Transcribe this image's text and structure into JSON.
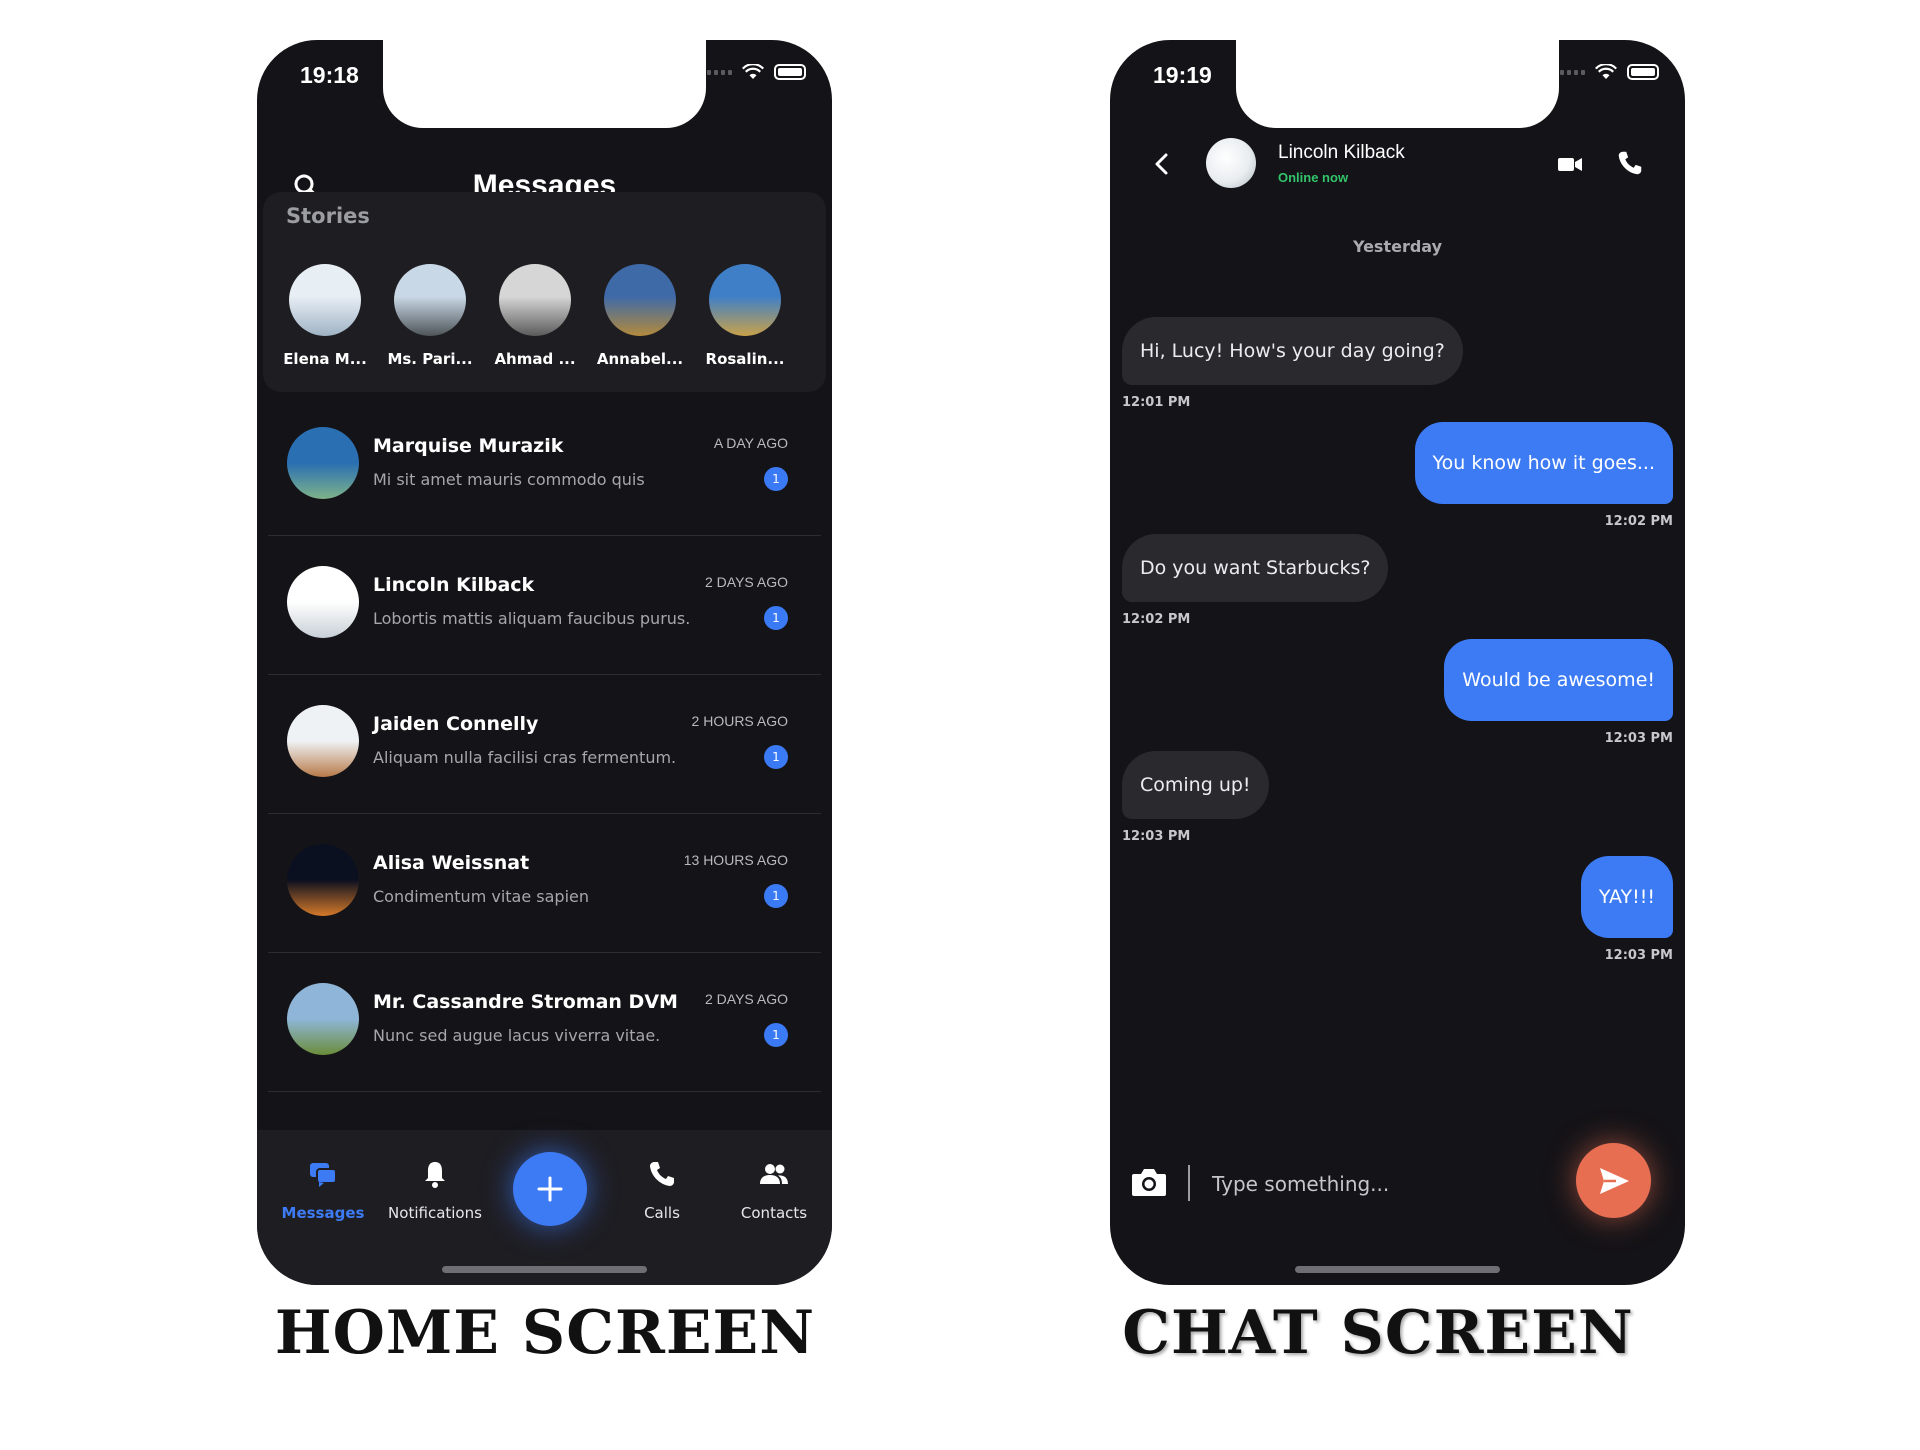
{
  "home": {
    "status_time": "19:18",
    "title": "Messages",
    "stories_title": "Stories",
    "stories": [
      {
        "name": "Elena M...",
        "colors": [
          "#e7eef4",
          "#9fb3c5"
        ]
      },
      {
        "name": "Ms. Pari...",
        "colors": [
          "#c9d8e6",
          "#4e5559"
        ]
      },
      {
        "name": "Ahmad ...",
        "colors": [
          "#d6d6d6",
          "#5b5b5b"
        ]
      },
      {
        "name": "Annabel...",
        "colors": [
          "#3f6aa8",
          "#b38a3c"
        ]
      },
      {
        "name": "Rosalin...",
        "colors": [
          "#3f7fc7",
          "#c9a24a"
        ]
      }
    ],
    "chats": [
      {
        "name": "Marquise Murazik",
        "preview": "Mi sit amet mauris commodo quis",
        "time": "A DAY AGO",
        "unread": "1",
        "colors": [
          "#2a6fb2",
          "#7fb38a"
        ]
      },
      {
        "name": "Lincoln Kilback",
        "preview": "Lobortis mattis aliquam faucibus purus.",
        "time": "2 DAYS AGO",
        "unread": "1",
        "colors": [
          "#ffffff",
          "#c7cfd6"
        ]
      },
      {
        "name": "Jaiden Connelly",
        "preview": "Aliquam nulla facilisi cras fermentum.",
        "time": "2 HOURS AGO",
        "unread": "1",
        "colors": [
          "#eef2f4",
          "#b87a4a"
        ]
      },
      {
        "name": "Alisa Weissnat",
        "preview": "Condimentum vitae sapien",
        "time": "13 HOURS AGO",
        "unread": "1",
        "colors": [
          "#0b1020",
          "#d67a2a"
        ]
      },
      {
        "name": "Mr. Cassandre Stroman DVM",
        "preview": "Nunc sed augue lacus viverra vitae.",
        "time": "2 DAYS AGO",
        "unread": "1",
        "colors": [
          "#8fb6d8",
          "#6b8d3a"
        ]
      }
    ],
    "tabs": [
      {
        "label": "Messages",
        "icon": "chat-bubbles-icon",
        "active": true
      },
      {
        "label": "Notifications",
        "icon": "bell-icon"
      },
      {
        "label": "Calls",
        "icon": "phone-icon"
      },
      {
        "label": "Contacts",
        "icon": "people-icon"
      }
    ],
    "fab_icon": "plus-icon"
  },
  "chat": {
    "status_time": "19:19",
    "contact_name": "Lincoln Kilback",
    "contact_status": "Online now",
    "day_separator": "Yesterday",
    "messages": [
      {
        "text": "Hi, Lucy! How's your day going?",
        "time": "12:01 PM",
        "dir": "in"
      },
      {
        "text": "You know how it goes...",
        "time": "12:02 PM",
        "dir": "out"
      },
      {
        "text": "Do you want Starbucks?",
        "time": "12:02 PM",
        "dir": "in"
      },
      {
        "text": "Would be awesome!",
        "time": "12:03 PM",
        "dir": "out"
      },
      {
        "text": "Coming up!",
        "time": "12:03 PM",
        "dir": "in"
      },
      {
        "text": "YAY!!!",
        "time": "12:03 PM",
        "dir": "out"
      }
    ],
    "input_placeholder": "Type something..."
  },
  "captions": {
    "home": "HOME SCREEN",
    "chat": "CHAT SCREEN"
  },
  "colors": {
    "accent": "#3d7bf4",
    "send": "#e86e52",
    "online": "#33c46b",
    "background": "#141317"
  }
}
